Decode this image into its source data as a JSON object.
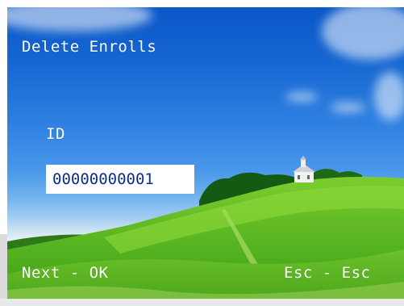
{
  "screen": {
    "title": "Delete Enrolls"
  },
  "form": {
    "id_label": "ID",
    "id_value": "00000000001"
  },
  "softkeys": {
    "left": "Next - OK",
    "right": "Esc - Esc"
  }
}
